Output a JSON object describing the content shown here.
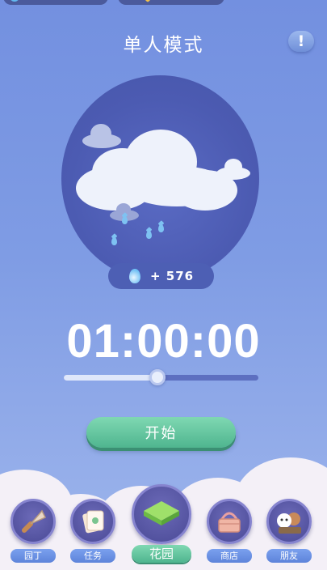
{
  "header": {
    "title": "单人模式",
    "alert_icon": "exclamation-icon",
    "alert_symbol": "!"
  },
  "scene": {
    "weather": "rain-cloud-icon"
  },
  "reward": {
    "icon": "water-drop-icon",
    "text": "+ 576"
  },
  "timer": {
    "value": "01:00:00"
  },
  "slider": {
    "fraction": 0.48
  },
  "start_button": {
    "label": "开始"
  },
  "nav": {
    "items": [
      {
        "label": "园丁",
        "icon": "trowel-icon"
      },
      {
        "label": "任务",
        "icon": "task-cards-icon"
      },
      {
        "label": "花园",
        "icon": "grass-tile-icon",
        "active": true
      },
      {
        "label": "商店",
        "icon": "basket-icon"
      },
      {
        "label": "朋友",
        "icon": "friends-icon"
      }
    ]
  },
  "colors": {
    "accent_green": "#5cc49e",
    "background": "#7f9ce4",
    "circle": "#4c5bb2"
  }
}
